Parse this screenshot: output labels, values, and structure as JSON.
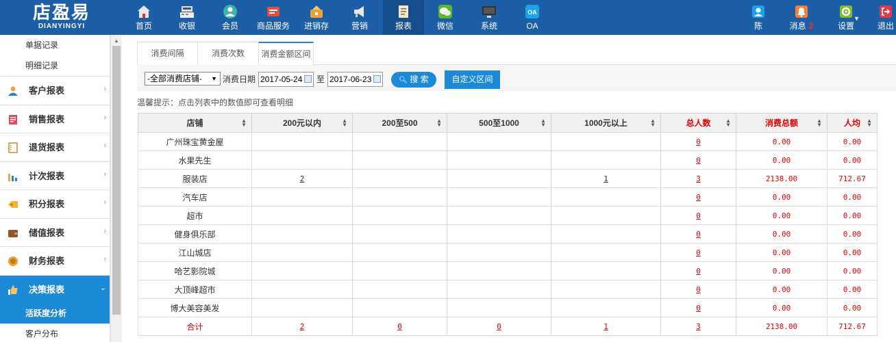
{
  "header": {
    "logo_main": "店盈易",
    "logo_sub": "DIANYINGYI",
    "nav": [
      {
        "label": "首页",
        "icon": "home-icon"
      },
      {
        "label": "收银",
        "icon": "cash-register-icon"
      },
      {
        "label": "会员",
        "icon": "member-icon"
      },
      {
        "label": "商品服务",
        "icon": "goods-icon"
      },
      {
        "label": "进销存",
        "icon": "inventory-icon"
      },
      {
        "label": "营销",
        "icon": "megaphone-icon"
      },
      {
        "label": "报表",
        "icon": "report-icon",
        "active": true
      },
      {
        "label": "微信",
        "icon": "wechat-icon"
      },
      {
        "label": "系统",
        "icon": "monitor-icon"
      },
      {
        "label": "OA",
        "icon": "oa-icon"
      }
    ],
    "user_label": "陈",
    "message_label": "消息",
    "message_count": "2",
    "settings_label": "设置",
    "logout_label": "退出"
  },
  "sidebar": {
    "top_items": [
      "单据记录",
      "明细记录"
    ],
    "groups": [
      {
        "label": "客户报表",
        "icon": "customer-icon"
      },
      {
        "label": "销售报表",
        "icon": "sales-icon"
      },
      {
        "label": "退货报表",
        "icon": "return-icon"
      },
      {
        "label": "计次报表",
        "icon": "count-chart-icon"
      },
      {
        "label": "积分报表",
        "icon": "points-tag-icon"
      },
      {
        "label": "储值报表",
        "icon": "wallet-icon"
      },
      {
        "label": "财务报表",
        "icon": "coin-icon"
      },
      {
        "label": "决策报表",
        "icon": "thumbs-up-icon",
        "open": true
      }
    ],
    "sub_items": [
      {
        "label": "活跃度分析",
        "active": true
      },
      {
        "label": "客户分布"
      }
    ]
  },
  "tabs": [
    "消费间隔",
    "消费次数",
    "消费金额区间"
  ],
  "filter": {
    "store_select": "-全部消费店铺-",
    "date_label": "消费日期",
    "date_from": "2017-05-24",
    "to_label": "至",
    "date_to": "2017-06-23",
    "search_label": "搜 索",
    "custom_label": "自定义区间"
  },
  "hint": "温馨提示：点击列表中的数值即可查看明细",
  "table": {
    "columns": [
      "店铺",
      "200元以内",
      "200至500",
      "500至1000",
      "1000元以上",
      "总人数",
      "消费总额",
      "人均"
    ],
    "rows": [
      [
        "广州珠宝黄金屋",
        "",
        "",
        "",
        "",
        "0",
        "0.00",
        "0.00"
      ],
      [
        "水果先生",
        "",
        "",
        "",
        "",
        "0",
        "0.00",
        "0.00"
      ],
      [
        "服装店",
        "2",
        "",
        "",
        "1",
        "3",
        "2138.00",
        "712.67"
      ],
      [
        "汽车店",
        "",
        "",
        "",
        "",
        "0",
        "0.00",
        "0.00"
      ],
      [
        "超市",
        "",
        "",
        "",
        "",
        "0",
        "0.00",
        "0.00"
      ],
      [
        "健身俱乐部",
        "",
        "",
        "",
        "",
        "0",
        "0.00",
        "0.00"
      ],
      [
        "江山城店",
        "",
        "",
        "",
        "",
        "0",
        "0.00",
        "0.00"
      ],
      [
        "哈艺影院城",
        "",
        "",
        "",
        "",
        "0",
        "0.00",
        "0.00"
      ],
      [
        "大顶峰超市",
        "",
        "",
        "",
        "",
        "0",
        "0.00",
        "0.00"
      ],
      [
        "博大美容美发",
        "",
        "",
        "",
        "",
        "0",
        "0.00",
        "0.00"
      ]
    ],
    "total": [
      "合计",
      "2",
      "0",
      "0",
      "1",
      "3",
      "2138.00",
      "712.67"
    ]
  },
  "colors": {
    "header_bg": "#1d5fa6",
    "accent": "#1d8ad8",
    "alert_red": "#e60000"
  }
}
